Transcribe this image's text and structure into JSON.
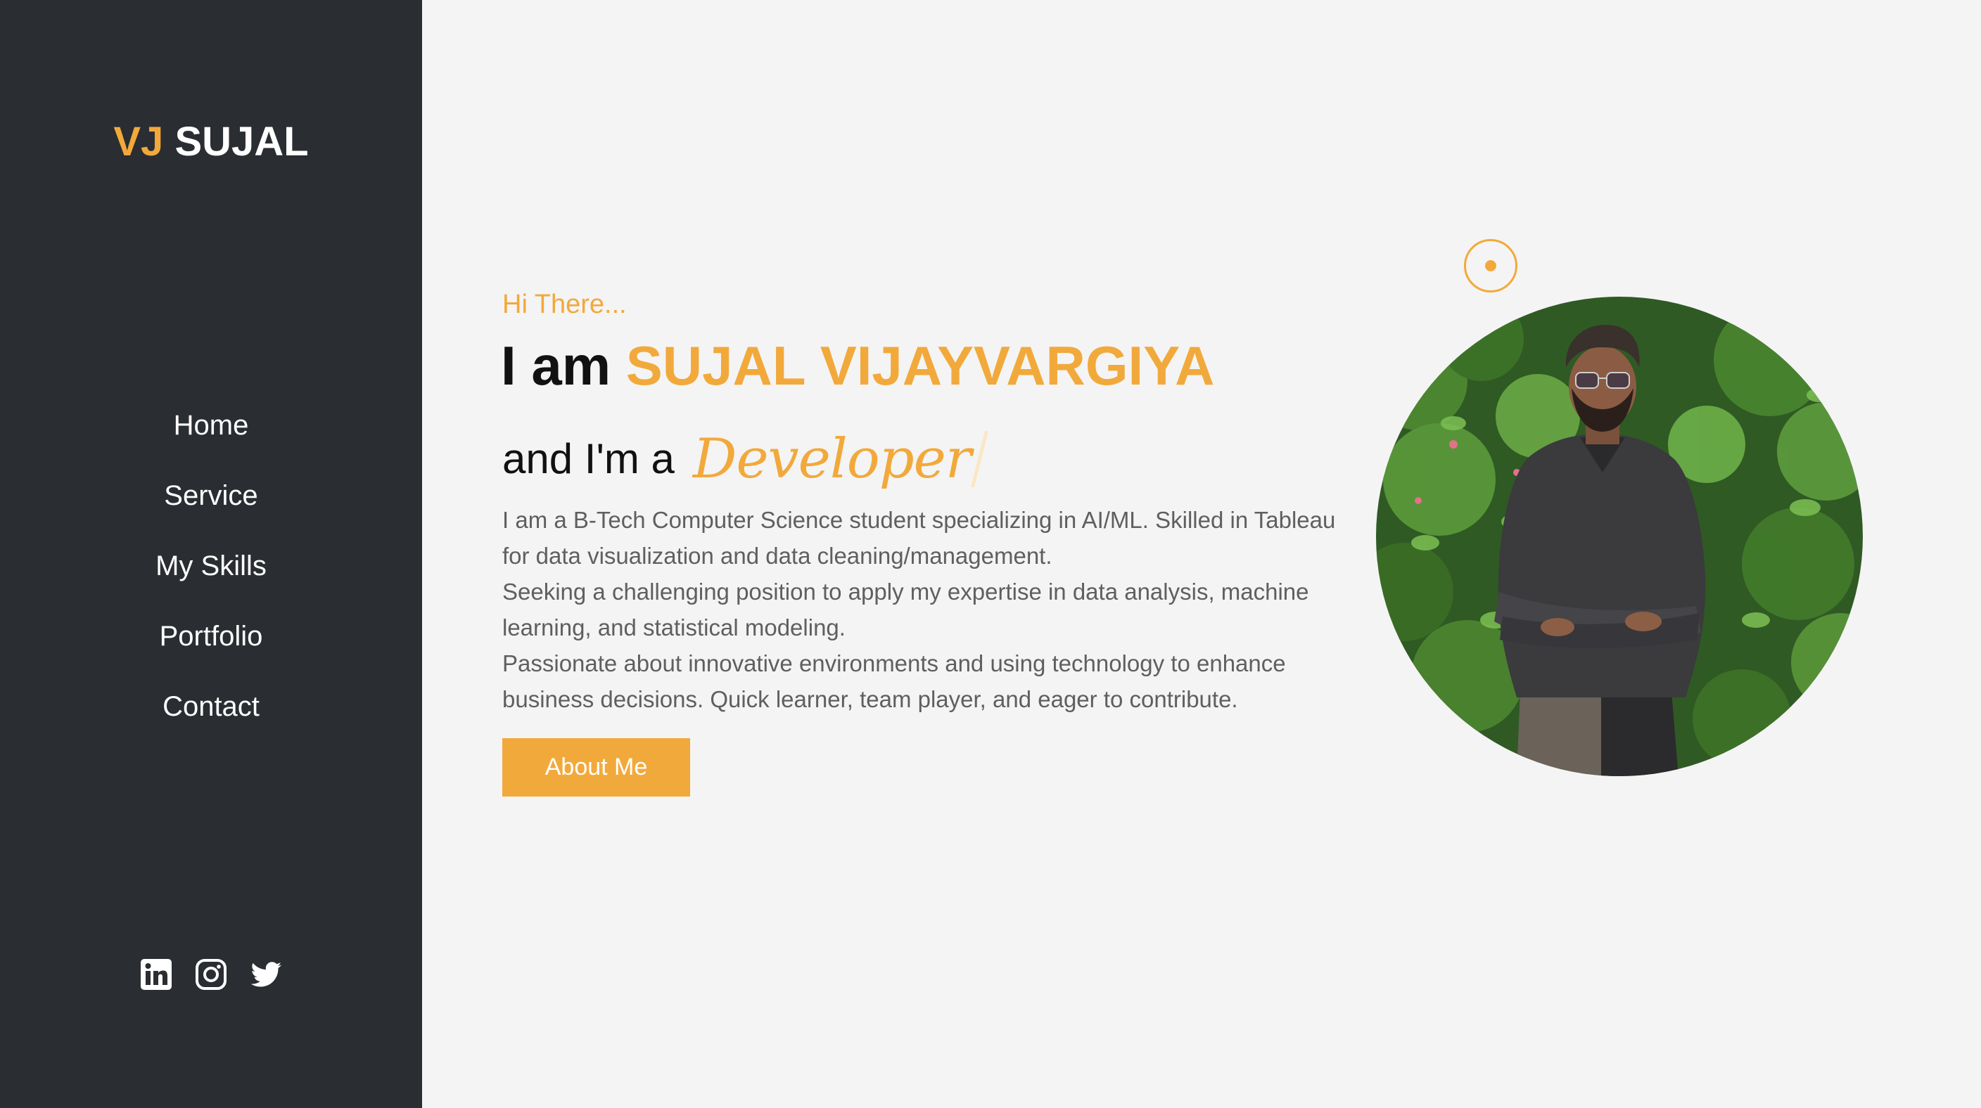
{
  "brand": {
    "accent": "VJ",
    "name": "SUJAL"
  },
  "nav": {
    "items": [
      {
        "label": "Home"
      },
      {
        "label": "Service"
      },
      {
        "label": "My Skills"
      },
      {
        "label": "Portfolio"
      },
      {
        "label": "Contact"
      }
    ]
  },
  "socials": [
    {
      "icon": "linkedin-icon"
    },
    {
      "icon": "instagram-icon"
    },
    {
      "icon": "twitter-icon"
    }
  ],
  "hero": {
    "greeting": "Hi There...",
    "intro_prefix": "I am",
    "full_name": "SUJAL VIJAYVARGIYA",
    "role_prefix": "and I'm a",
    "role": "Developer",
    "bio": [
      "I am a B-Tech Computer Science student specializing in AI/ML. Skilled in Tableau for data visualization and data cleaning/management.",
      "Seeking a challenging position to apply my expertise in data analysis, machine learning, and statistical modeling.",
      "Passionate about innovative environments and using technology to enhance business decisions. Quick learner, team player, and eager to contribute."
    ],
    "button_label": "About Me"
  },
  "colors": {
    "accent": "#f2a93b",
    "sidebar_bg": "#2a2d32",
    "page_bg": "#f4f4f4",
    "heading": "#111111",
    "body_text": "#5f5f5f"
  }
}
